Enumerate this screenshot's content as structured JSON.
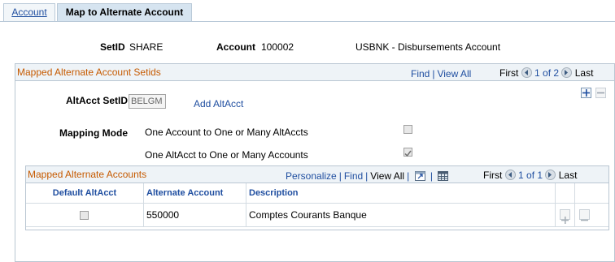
{
  "tabs": [
    {
      "label": "Account",
      "active": false
    },
    {
      "label": "Map to Alternate Account",
      "active": true
    }
  ],
  "header": {
    "setid_label": "SetID",
    "setid_value": "SHARE",
    "account_label": "Account",
    "account_value": "100002",
    "account_desc": "USBNK - Disbursements Account"
  },
  "outer_grid": {
    "title": "Mapped Alternate Account Setids",
    "find": "Find",
    "view_all": "View All",
    "first": "First",
    "page_info": "1 of 2",
    "last": "Last",
    "altacct_setid_label": "AltAcct SetID",
    "altacct_setid_value": "BELGM",
    "add_altacct": "Add AltAcct",
    "mapping_mode_label": "Mapping Mode",
    "mode_options": [
      {
        "label": "One Account to One or Many AltAccts",
        "checked": false
      },
      {
        "label": "One AltAcct to One or Many Accounts",
        "checked": true
      }
    ]
  },
  "inner_grid": {
    "title": "Mapped Alternate Accounts",
    "personalize": "Personalize",
    "find": "Find",
    "view_all": "View All",
    "first": "First",
    "page_info": "1 of 1",
    "last": "Last",
    "columns": [
      "Default AltAcct",
      "Alternate Account",
      "Description"
    ],
    "rows": [
      {
        "default": false,
        "alternate_account": "550000",
        "description": "Comptes Courants Banque"
      }
    ]
  },
  "colors": {
    "link": "#1f4ea0",
    "grid_title": "#c65a00",
    "tab_active_bg": "#d6e4f0",
    "border": "#b9c6d2"
  },
  "icons": [
    "prev-arrow-icon",
    "next-arrow-icon",
    "plus-icon",
    "minus-icon",
    "zoom-grid-icon",
    "download-grid-icon",
    "checkbox-icon"
  ]
}
